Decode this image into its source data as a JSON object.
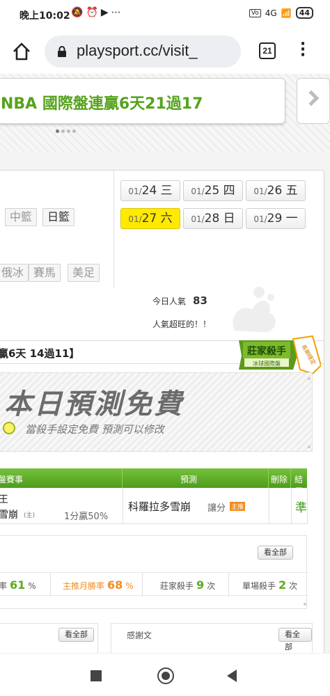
{
  "statusbar": {
    "time": "晚上10:02",
    "icons": [
      "mute-icon",
      "alarm-icon",
      "youtube-icon",
      "more-dots"
    ],
    "network": "4G",
    "battery": "44"
  },
  "browser": {
    "url": "playsport.cc/visit_",
    "tab_count": "21"
  },
  "banner": {
    "text": "NBA 國際盤連贏6天21過17"
  },
  "categories": {
    "row1": [
      "中籃",
      "日籃"
    ],
    "row2": [
      "俄冰",
      "賽馬",
      "美足"
    ]
  },
  "dates": [
    {
      "md": "01/",
      "day": "24 三",
      "selected": false
    },
    {
      "md": "01/",
      "day": "25 四",
      "selected": false
    },
    {
      "md": "01/",
      "day": "26 五",
      "selected": false
    },
    {
      "md": "01/",
      "day": "27 六",
      "selected": true
    },
    {
      "md": "01/",
      "day": "28 日",
      "selected": false
    },
    {
      "md": "01/",
      "day": "29 一",
      "selected": false
    }
  ],
  "popularity": {
    "label": "今日人氣",
    "value": "83",
    "comment": "人氣超旺的！！"
  },
  "record": {
    "text": "贏6天 14過11】"
  },
  "badge": {
    "title": "莊家殺手",
    "subtitle": "冰球國際盤",
    "ribbon": "長期穩定"
  },
  "free_promo": {
    "title": "本日預測免費",
    "subtitle": "當殺手設定免費  預測可以修改"
  },
  "table": {
    "headers": [
      "盤賽事",
      "預測",
      "刪除",
      "結果"
    ],
    "rows": [
      {
        "team_top": "王",
        "team_bottom": "雪崩",
        "team_tag": "(主)",
        "handicap": "1分贏50%",
        "prediction": "科羅拉多雪崩",
        "prediction_type": "讓分",
        "prediction_tag": "主推",
        "result": "準"
      }
    ]
  },
  "stats": {
    "see_all": "看全部",
    "items": [
      {
        "label": "率",
        "value": "61",
        "unit": "%"
      },
      {
        "label": "主推月勝率",
        "value": "68",
        "unit": "%"
      },
      {
        "label": "莊家殺手",
        "value": "9",
        "unit": "次"
      },
      {
        "label": "單場殺手",
        "value": "2",
        "unit": "次"
      }
    ]
  },
  "lower": {
    "left_see_all": "看全部",
    "right_title": "感謝文",
    "right_see_all": "看全部"
  },
  "colors": {
    "green": "#55a31b",
    "yellow": "#ffea00",
    "orange": "#f28c1d"
  }
}
